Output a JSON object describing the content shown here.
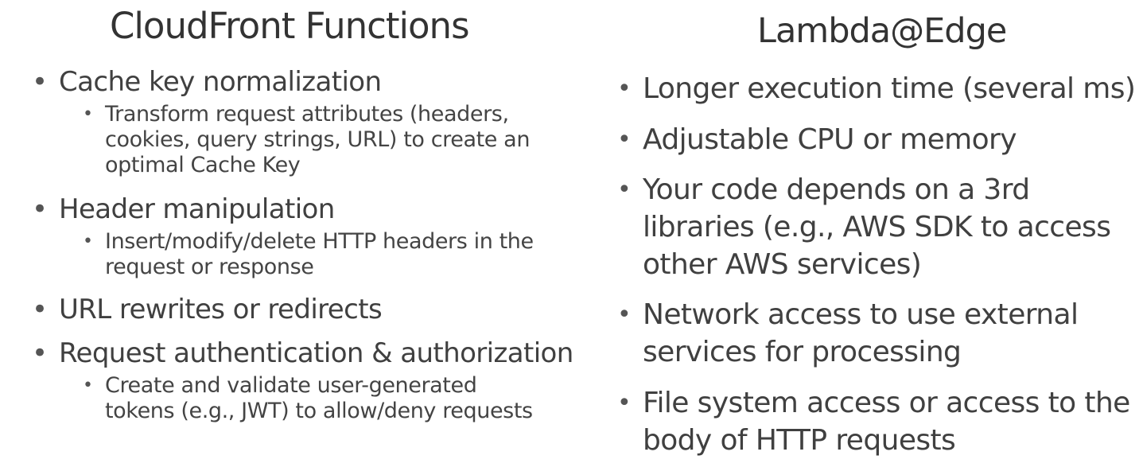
{
  "left": {
    "title": "CloudFront Functions",
    "items": [
      {
        "text": "Cache key normalization",
        "sub": [
          "Transform request attributes (headers, cookies, query strings, URL) to create an optimal Cache Key"
        ]
      },
      {
        "text": "Header manipulation",
        "sub": [
          "Insert/modify/delete HTTP headers in the request or response"
        ]
      },
      {
        "text": "URL rewrites or redirects",
        "sub": []
      },
      {
        "text": "Request authentication & authorization",
        "sub": [
          "Create and validate user-generated tokens (e.g., JWT) to allow/deny requests"
        ]
      }
    ]
  },
  "right": {
    "title": "Lambda@Edge",
    "items": [
      "Longer execution time (several ms)",
      "Adjustable CPU or memory",
      "Your code depends on a 3rd libraries (e.g., AWS SDK to access other AWS services)",
      "Network access to use external services for processing",
      "File system access or access to the body of HTTP requests"
    ]
  }
}
